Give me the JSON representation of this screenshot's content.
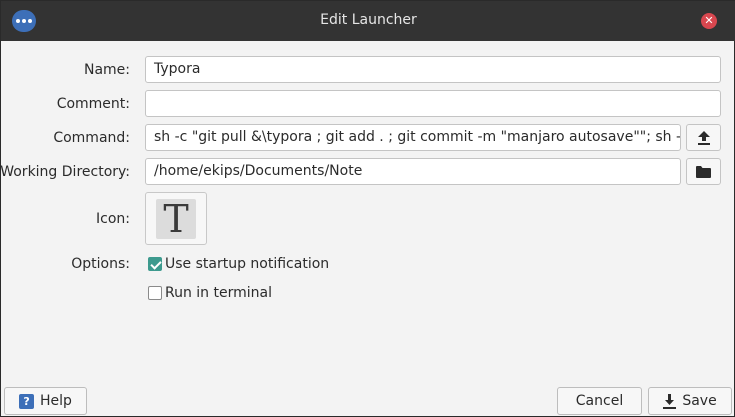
{
  "window": {
    "title": "Edit Launcher",
    "menu_icon": "more-dots-icon",
    "close_icon": "close-icon",
    "close_color": "#d8474f",
    "accent": "#3d6fb8"
  },
  "form": {
    "name": {
      "label": "Name:",
      "value": "Typora"
    },
    "comment": {
      "label": "Comment:",
      "value": ""
    },
    "command": {
      "label": "Command:",
      "value": "sh -c \"git pull &\\typora ; git add . ; git commit -m \"manjaro autosave\"\"; sh -c \"git push\"",
      "button_icon": "upload-icon"
    },
    "working_directory": {
      "label": "Working Directory:",
      "value": "/home/ekips/Documents/Note",
      "button_icon": "folder-icon"
    },
    "icon": {
      "label": "Icon:",
      "glyph": "T"
    },
    "options": {
      "label": "Options:",
      "startup_notification": {
        "label": "Use startup notification",
        "checked": true
      },
      "run_in_terminal": {
        "label": "Run in terminal",
        "checked": false
      }
    }
  },
  "buttons": {
    "help": {
      "label": "Help",
      "icon": "help-icon"
    },
    "cancel": {
      "label": "Cancel"
    },
    "save": {
      "label": "Save",
      "icon": "save-download-icon"
    }
  },
  "colors": {
    "checkbox_checked": "#3d9a8e"
  }
}
